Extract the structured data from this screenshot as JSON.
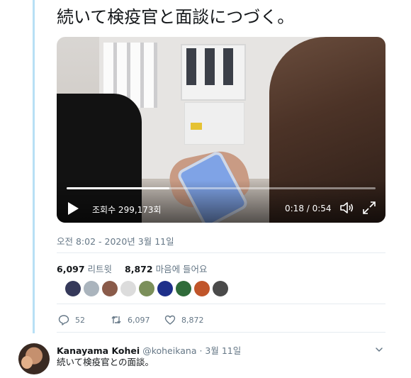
{
  "tweet": {
    "text": "続いて検疫官と面談につづく。",
    "timestamp": "오전 8:02 - 2020년 3월 11일"
  },
  "video": {
    "views_label": "조회수 299,173회",
    "time_label": "0:18 / 0:54",
    "progress": 0.333
  },
  "stats": {
    "retweets_count": "6,097",
    "retweets_label": "리트윗",
    "likes_count": "8,872",
    "likes_label": "마음에 들어요"
  },
  "liker_avatars": [
    {
      "name": "avatar-1",
      "color": "#35395a"
    },
    {
      "name": "avatar-2",
      "color": "#aab4bd"
    },
    {
      "name": "avatar-3",
      "color": "#8a5b4a"
    },
    {
      "name": "avatar-4",
      "color": "#dcdcdc"
    },
    {
      "name": "avatar-5",
      "color": "#7b8f5a"
    },
    {
      "name": "avatar-6",
      "color": "#1e2f8a"
    },
    {
      "name": "avatar-7",
      "color": "#2f6b3a"
    },
    {
      "name": "avatar-8",
      "color": "#c0552a"
    },
    {
      "name": "avatar-9",
      "color": "#4a4a4a"
    }
  ],
  "actions": {
    "replies": "52",
    "retweets": "6,097",
    "likes": "8,872"
  },
  "reply": {
    "name": "Kanayama Kohei",
    "handle_date": "@koheikana · 3월 11일",
    "text": "続いて検疫官との面談。"
  },
  "colors": {
    "thread_line": "#b8e0f5",
    "secondary_text": "#657786"
  }
}
